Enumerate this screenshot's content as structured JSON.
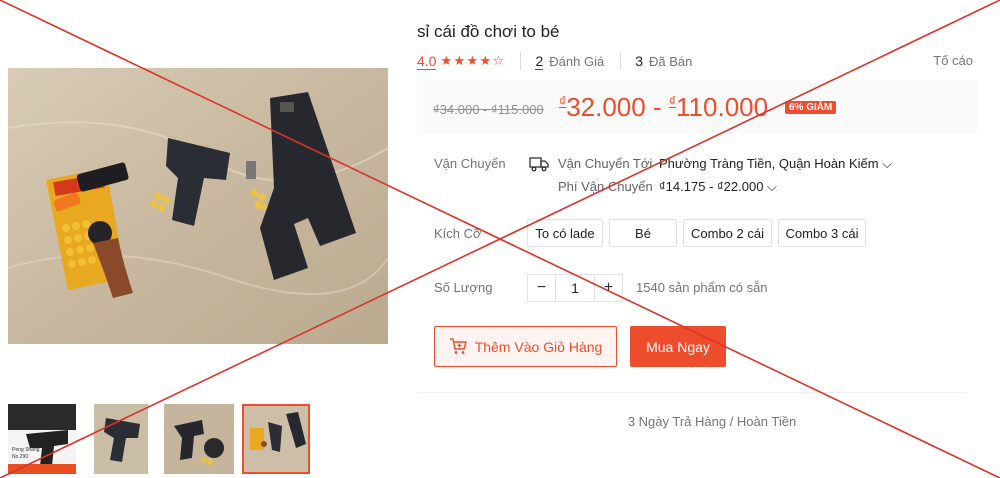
{
  "product": {
    "title": "sỉ cái đồ chơi to bé",
    "rating": "4.0",
    "stars": 4,
    "review_count": "2",
    "review_label": "Đánh Giá",
    "sold_count": "3",
    "sold_label": "Đã Bán",
    "report_label": "Tố cáo"
  },
  "price": {
    "old": "₫34.000 - ₫115.000",
    "currency": "₫",
    "low": "32.000",
    "separator": " - ",
    "high": "110.000",
    "discount": "6% GIẢM"
  },
  "shipping": {
    "label": "Vận Chuyển",
    "to_label": "Vận Chuyển Tới",
    "destination": "Phường Tràng Tiền, Quận Hoàn Kiếm",
    "fee_label": "Phí Vận Chuyển",
    "fee": "₫14.175 - ₫22.000"
  },
  "size": {
    "label": "Kích Cỡ",
    "options": [
      "To có lade",
      "Bé",
      "Combo 2 cái",
      "Combo 3 cái"
    ]
  },
  "quantity": {
    "label": "Số Lượng",
    "minus": "−",
    "value": "1",
    "plus": "+",
    "stock": "1540 sản phẩm có sẵn"
  },
  "actions": {
    "add_to_cart": "Thêm Vào Giỏ Hàng",
    "buy_now": "Mua Ngay"
  },
  "return_policy": "3 Ngày Trả Hàng / Hoàn Tiền",
  "thumbnail": {
    "box_text": "Peng Shang",
    "model_text": "No.290"
  },
  "colors": {
    "accent": "#ee4d2d",
    "cross": "#d9342b"
  }
}
